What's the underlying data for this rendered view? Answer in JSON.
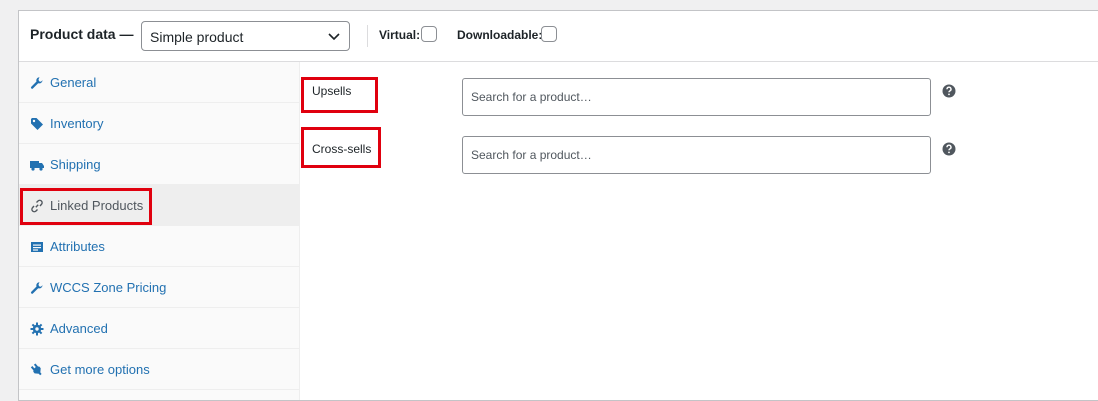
{
  "header": {
    "title": "Product data —",
    "product_type": "Simple product",
    "virtual_label": "Virtual:",
    "downloadable_label": "Downloadable:"
  },
  "sidebar": {
    "items": [
      {
        "label": "General",
        "icon": "wrench-icon"
      },
      {
        "label": "Inventory",
        "icon": "tag-icon"
      },
      {
        "label": "Shipping",
        "icon": "truck-icon"
      },
      {
        "label": "Linked Products",
        "icon": "link-icon",
        "active": true
      },
      {
        "label": "Attributes",
        "icon": "list-icon"
      },
      {
        "label": "WCCS Zone Pricing",
        "icon": "wrench-icon"
      },
      {
        "label": "Advanced",
        "icon": "gear-icon"
      },
      {
        "label": "Get more options",
        "icon": "plugin-icon"
      }
    ]
  },
  "linked_products": {
    "upsells_label": "Upsells",
    "upsells_placeholder": "Search for a product…",
    "cross_sells_label": "Cross-sells",
    "cross_sells_placeholder": "Search for a product…"
  },
  "colors": {
    "accent_link": "#2271b1",
    "highlight_red": "#e0000e",
    "help_icon": "#50575e"
  }
}
